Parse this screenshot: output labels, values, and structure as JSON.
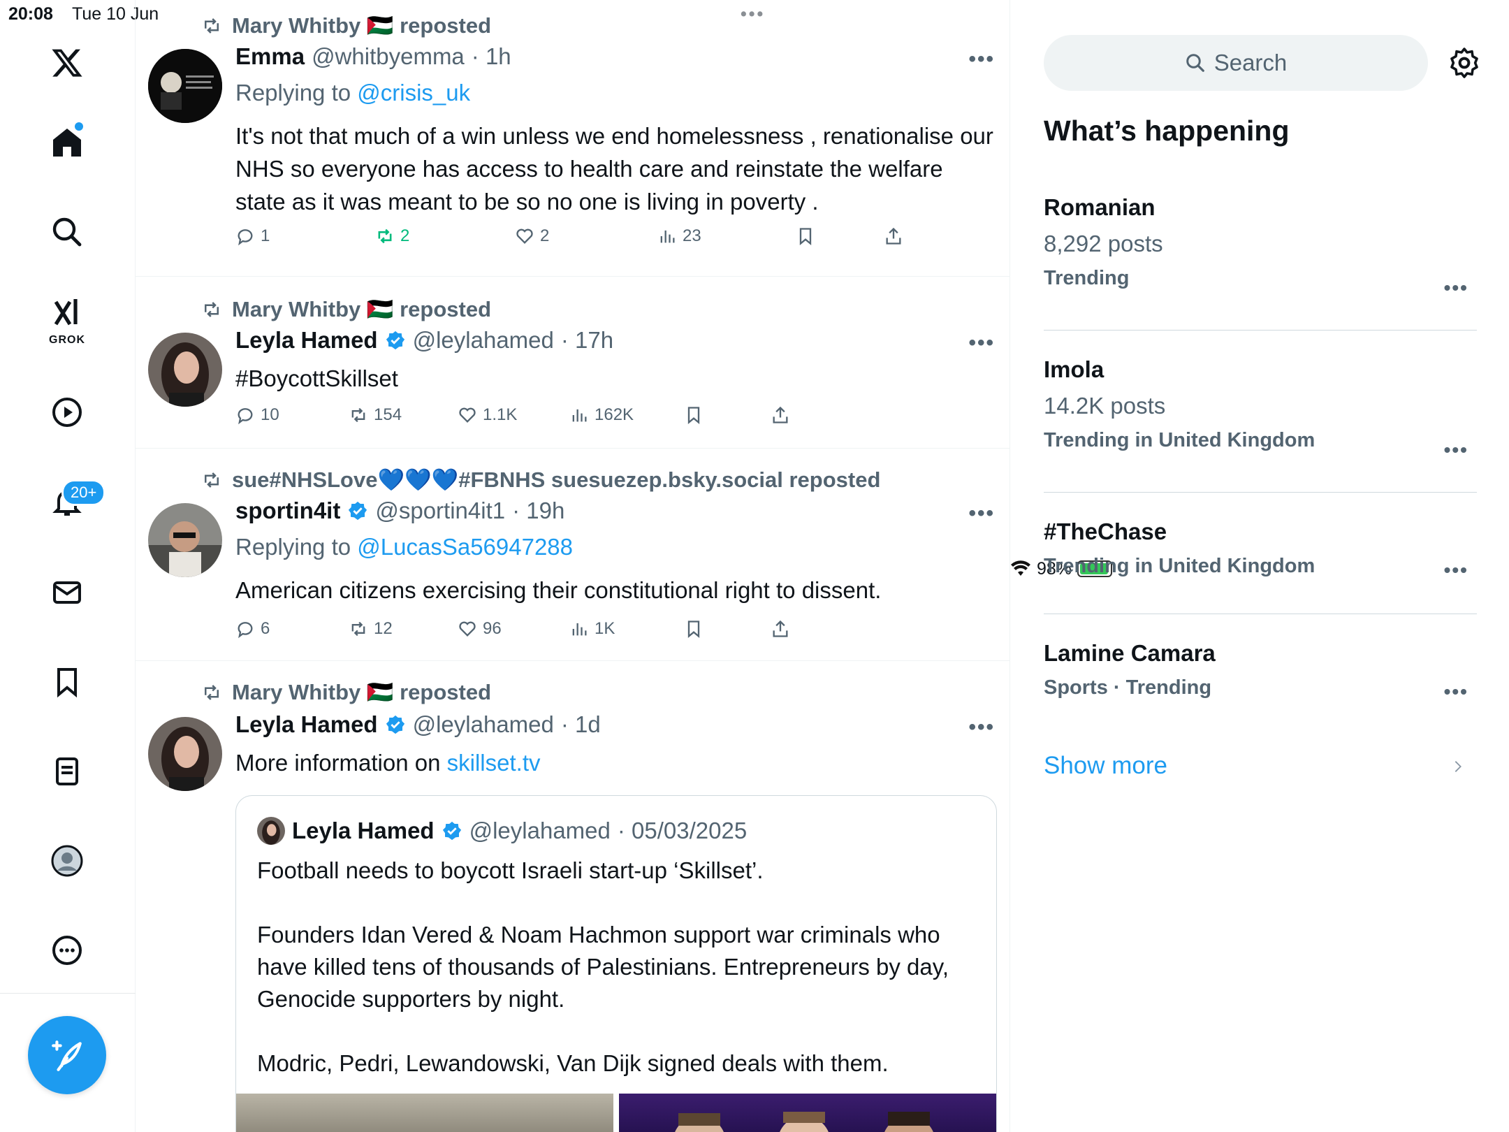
{
  "status_bar": {
    "time": "20:08",
    "date": "Tue 10 Jun",
    "battery": "98%"
  },
  "nav": {
    "badge": "20+",
    "grok_label": "GROK",
    "items": [
      "X",
      "Home",
      "Search",
      "Grok",
      "Videos",
      "Notifications",
      "Messages",
      "Bookmarks",
      "Lists",
      "Profile",
      "More"
    ]
  },
  "tweets": [
    {
      "reposted_by": "Mary Whitby 🇵🇸 reposted",
      "name": "Emma",
      "handle": "@whitbyemma",
      "time": "· 1h",
      "replying_prefix": "Replying to ",
      "replying_to": "@crisis_uk",
      "text": "It's not that much of a win unless we end homelessness , renationalise our NHS so everyone has access to health care and reinstate the welfare state as it was meant to be so no one is living in poverty .",
      "replies": "1",
      "reposts": "2",
      "likes": "2",
      "views": "23"
    },
    {
      "reposted_by": "Mary Whitby 🇵🇸 reposted",
      "name": "Leyla Hamed",
      "handle": "@leylahamed",
      "time": "· 17h",
      "text": "#BoycottSkillset",
      "replies": "10",
      "reposts": "154",
      "likes": "1.1K",
      "views": "162K"
    },
    {
      "reposted_by": "sue#NHSLove💙💙💙#FBNHS suesuezep.bsky.social reposted",
      "name": "sportin4it",
      "handle": "@sportin4it1",
      "time": "· 19h",
      "replying_prefix": "Replying to ",
      "replying_to": "@LucasSa56947288",
      "text": "American citizens exercising their constitutional right to dissent.",
      "replies": "6",
      "reposts": "12",
      "likes": "96",
      "views": "1K"
    },
    {
      "reposted_by": "Mary Whitby 🇵🇸 reposted",
      "name": "Leyla Hamed",
      "handle": "@leylahamed",
      "time": "· 1d",
      "text_prefix": "More information on ",
      "text_link": "skillset.tv",
      "quote": {
        "name": "Leyla Hamed",
        "handle": "@leylahamed",
        "time": "· 05/03/2025",
        "text": "Football needs to boycott Israeli start-up ‘Skillset’.\n\nFounders Idan Vered & Noam Hachmon support war criminals who have killed tens of thousands of Palestinians. Entrepreneurs by day, Genocide supporters by night.\n\nModric, Pedri, Lewandowski, Van Dijk signed deals with them."
      }
    }
  ],
  "sidebar": {
    "search_placeholder": "Search",
    "title": "What’s happening",
    "trends": [
      {
        "name": "Romanian",
        "count": "8,292 posts",
        "meta": "Trending"
      },
      {
        "name": "Imola",
        "count": "14.2K posts",
        "meta": "Trending in United Kingdom"
      },
      {
        "name": "#TheChase",
        "meta": "Trending in United Kingdom"
      },
      {
        "name": "Lamine Camara",
        "meta": "Sports · Trending"
      }
    ],
    "show_more": "Show more"
  },
  "colors": {
    "accent": "#1d9bf0",
    "secondary_text": "#536471",
    "repost_active": "#00ba7c"
  }
}
